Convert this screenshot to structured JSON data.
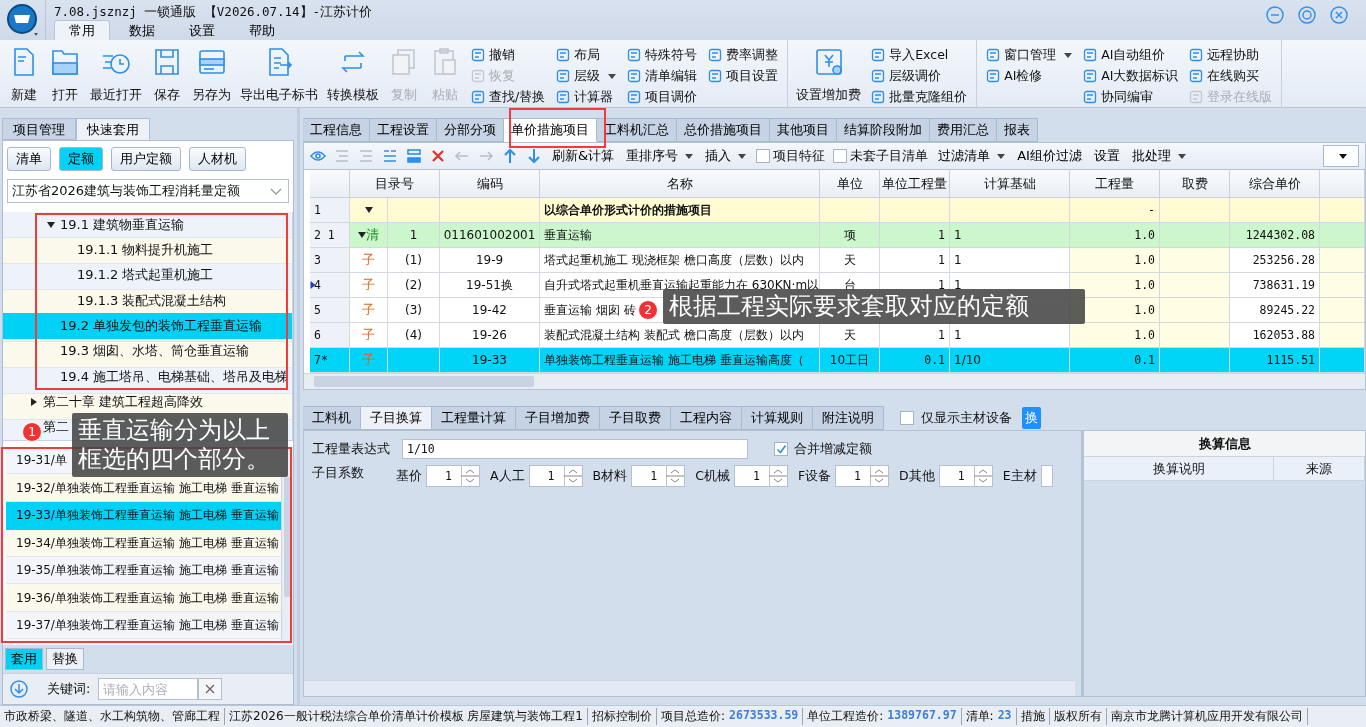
{
  "window": {
    "title": "7.08.jsznzj 一锁通版 【V2026.07.14】-江苏计价"
  },
  "menu_tabs": [
    {
      "label": "常用",
      "selected": true
    },
    {
      "label": "数据",
      "selected": false
    },
    {
      "label": "设置",
      "selected": false
    },
    {
      "label": "帮助",
      "selected": false
    }
  ],
  "toolbar": [
    [
      {
        "kind": "big",
        "label": "新建",
        "disabled": false
      },
      {
        "kind": "big",
        "label": "打开",
        "disabled": false
      },
      {
        "kind": "big",
        "label": "最近打开",
        "disabled": false
      },
      {
        "kind": "big",
        "label": "保存",
        "disabled": false
      },
      {
        "kind": "big",
        "label": "另存为",
        "disabled": false
      },
      {
        "kind": "big",
        "label": "导出电子标书",
        "disabled": false
      },
      {
        "kind": "big",
        "label": "转换模板",
        "disabled": false
      },
      {
        "kind": "big",
        "label": "复制",
        "disabled": true
      },
      {
        "kind": "big",
        "label": "粘贴",
        "disabled": true
      },
      {
        "kind": "column",
        "items": [
          {
            "label": "撤销",
            "disabled": false,
            "dropdown": false
          },
          {
            "label": "恢复",
            "disabled": true,
            "dropdown": false
          },
          {
            "label": "查找/替换",
            "disabled": false,
            "dropdown": false
          }
        ]
      },
      {
        "kind": "column",
        "items": [
          {
            "label": "布局",
            "disabled": false,
            "dropdown": false
          },
          {
            "label": "层级",
            "disabled": false,
            "dropdown": true
          },
          {
            "label": "计算器",
            "disabled": false,
            "dropdown": false
          }
        ]
      },
      {
        "kind": "column",
        "items": [
          {
            "label": "特殊符号",
            "disabled": false,
            "dropdown": false
          },
          {
            "label": "清单编辑",
            "disabled": false,
            "dropdown": false
          },
          {
            "label": "项目调价",
            "disabled": false,
            "dropdown": false
          }
        ]
      },
      {
        "kind": "column",
        "items": [
          {
            "label": "费率调整",
            "disabled": false,
            "dropdown": false
          },
          {
            "label": "项目设置",
            "disabled": false,
            "dropdown": false
          }
        ]
      }
    ],
    [
      {
        "kind": "big",
        "label": "设置增加费",
        "disabled": false
      },
      {
        "kind": "column",
        "items": [
          {
            "label": "导入Excel",
            "disabled": false,
            "dropdown": false
          },
          {
            "label": "层级调价",
            "disabled": false,
            "dropdown": false
          },
          {
            "label": "批量克隆组价",
            "disabled": false,
            "dropdown": false
          }
        ]
      }
    ],
    [
      {
        "kind": "column",
        "items": [
          {
            "label": "窗口管理",
            "disabled": false,
            "dropdown": true
          },
          {
            "label": "AI检修",
            "disabled": false,
            "dropdown": false
          }
        ]
      },
      {
        "kind": "column",
        "items": [
          {
            "label": "AI自动组价",
            "disabled": false,
            "dropdown": false
          },
          {
            "label": "AI大数据标识",
            "disabled": false,
            "dropdown": false
          },
          {
            "label": "协同编审",
            "disabled": false,
            "dropdown": false
          }
        ]
      },
      {
        "kind": "column",
        "items": [
          {
            "label": "远程协助",
            "disabled": false,
            "dropdown": false
          },
          {
            "label": "在线购买",
            "disabled": false,
            "dropdown": false
          },
          {
            "label": "登录在线版",
            "disabled": true,
            "dropdown": false
          }
        ]
      }
    ]
  ],
  "left_panel": {
    "tabs": [
      {
        "label": "项目管理",
        "selected": false
      },
      {
        "label": "快速套用",
        "selected": true
      }
    ],
    "filter_buttons": [
      {
        "label": "清单",
        "selected": false
      },
      {
        "label": "定额",
        "selected": true
      },
      {
        "label": "用户定额",
        "selected": false
      },
      {
        "label": "人材机",
        "selected": false
      }
    ],
    "library": {
      "value": "江苏省2026建筑与装饰工程消耗量定额"
    },
    "tree": [
      {
        "children": [
          {
            "label": "19.1 建筑物垂直运输",
            "expanded": true,
            "selected": false,
            "children": [
              {
                "label": "19.1.1 物料提升机施工",
                "selected": false
              },
              {
                "label": "19.1.2 塔式起重机施工",
                "selected": false
              },
              {
                "label": "19.1.3 装配式混凝土结构",
                "selected": false
              }
            ]
          },
          {
            "label": "19.2 单独发包的装饰工程垂直运输",
            "selected": true
          },
          {
            "label": "19.3 烟囱、水塔、筒仓垂直运输",
            "selected": false
          },
          {
            "label": "19.4 施工塔吊、电梯基础、塔吊及电梯",
            "selected": false
          }
        ]
      },
      {
        "label": "第二十章 建筑工程超高降效",
        "expanded": false,
        "selected": false
      },
      {
        "label": "第二",
        "selected": false
      }
    ],
    "norms": [
      {
        "text": "19-31/单",
        "selected": false
      },
      {
        "text": "19-32/单独装饰工程垂直运输 施工电梯 垂直运输",
        "selected": false
      },
      {
        "text": "19-33/单独装饰工程垂直运输 施工电梯 垂直运输",
        "selected": true
      },
      {
        "text": "19-34/单独装饰工程垂直运输 施工电梯 垂直运输",
        "selected": false
      },
      {
        "text": "19-35/单独装饰工程垂直运输 施工电梯 垂直运输",
        "selected": false
      },
      {
        "text": "19-36/单独装饰工程垂直运输 施工电梯 垂直运输",
        "selected": false
      },
      {
        "text": "19-37/单独装饰工程垂直运输 施工电梯 垂直运输",
        "selected": false
      }
    ],
    "action_tabs": [
      {
        "label": "套用",
        "selected": true
      },
      {
        "label": "替换",
        "selected": false
      }
    ],
    "keyword": {
      "label": "关键词:",
      "placeholder": "请输入内容"
    }
  },
  "main_tabs": [
    {
      "label": "工程信息",
      "selected": false
    },
    {
      "label": "工程设置",
      "selected": false
    },
    {
      "label": "分部分项",
      "selected": false
    },
    {
      "label": "单价措施项目",
      "selected": true
    },
    {
      "label": "工料机汇总",
      "selected": false
    },
    {
      "label": "总价措施项目",
      "selected": false
    },
    {
      "label": "其他项目",
      "selected": false
    },
    {
      "label": "结算阶段附加",
      "selected": false
    },
    {
      "label": "费用汇总",
      "selected": false
    },
    {
      "label": "报表",
      "selected": false
    }
  ],
  "grid_toolbar": {
    "icons": [
      {
        "kind": "eye",
        "disabled": false
      },
      {
        "kind": "lines",
        "disabled": true
      },
      {
        "kind": "lines",
        "disabled": true
      },
      {
        "kind": "list",
        "disabled": false
      },
      {
        "kind": "stack",
        "disabled": false
      },
      {
        "kind": "delete",
        "disabled": false
      },
      {
        "kind": "left",
        "disabled": true
      },
      {
        "kind": "right",
        "disabled": true
      },
      {
        "kind": "up",
        "disabled": false
      },
      {
        "kind": "down",
        "disabled": false
      }
    ],
    "items": [
      {
        "kind": "button",
        "label": "刷新&计算",
        "dropdown": false
      },
      {
        "kind": "button",
        "label": "重排序号",
        "dropdown": true
      },
      {
        "kind": "button",
        "label": "插入",
        "dropdown": true
      },
      {
        "kind": "checkbox",
        "label": "项目特征",
        "checked": false
      },
      {
        "kind": "checkbox",
        "label": "未套子目清单",
        "checked": false
      },
      {
        "kind": "button",
        "label": "过滤清单",
        "dropdown": true
      },
      {
        "kind": "button",
        "label": "AI组价过滤",
        "dropdown": false
      },
      {
        "kind": "button",
        "label": "设置",
        "dropdown": false
      },
      {
        "kind": "button",
        "label": "批处理",
        "dropdown": true
      }
    ]
  },
  "table": {
    "columns": [
      "目录号",
      "编码",
      "名称",
      "单位",
      "单位工程量",
      "计算基础",
      "工程量",
      "取费",
      "综合单价"
    ],
    "rows": [
      {
        "no": "1",
        "kind": "group",
        "expanded": true,
        "current": false,
        "selected": false,
        "name": "以综合单价形式计价的措施项目",
        "qty": "-"
      },
      {
        "no": "2 1",
        "kind": "list",
        "expanded": true,
        "tag": "清",
        "seq": "1",
        "current": false,
        "selected": false,
        "code": "011601002001",
        "name": "垂直运输",
        "unit": "项",
        "unit_qty": "1",
        "basis": "1",
        "qty": "1.0",
        "price": "1244302.08"
      },
      {
        "no": "3",
        "kind": "item",
        "tag": "子",
        "seq": "(1)",
        "current": false,
        "selected": false,
        "code": "19-9",
        "name": "塔式起重机施工 现浇框架 檐口高度（层数）以内",
        "unit": "天",
        "unit_qty": "1",
        "basis": "1",
        "qty": "1.0",
        "price": "253256.28"
      },
      {
        "no": "4",
        "kind": "item",
        "tag": "子",
        "seq": "(2)",
        "current": true,
        "selected": false,
        "code": "19-51换",
        "name": "自升式塔式起重机垂直运输起重能力在 630KN·m以",
        "unit": "台",
        "unit_qty": "1",
        "basis": "1",
        "qty": "1.0",
        "price": "738631.19"
      },
      {
        "no": "5",
        "kind": "item",
        "tag": "子",
        "seq": "(3)",
        "current": false,
        "selected": false,
        "code": "19-42",
        "name": "垂直运输 烟囱 砖",
        "qty": "1.0",
        "price": "89245.22"
      },
      {
        "no": "6",
        "kind": "item",
        "tag": "子",
        "seq": "(4)",
        "current": false,
        "selected": false,
        "code": "19-26",
        "name": "装配式混凝土结构 装配式 檐口高度（层数）以内",
        "unit": "天",
        "unit_qty": "1",
        "basis": "1",
        "qty": "1.0",
        "price": "162053.88"
      },
      {
        "no": "7*",
        "kind": "item",
        "tag": "子",
        "current": false,
        "selected": true,
        "code": "19-33",
        "name": "单独装饰工程垂直运输 施工电梯 垂直运输高度（",
        "unit": "10工日",
        "unit_qty": "0.1",
        "basis": "1/10",
        "qty": "0.1",
        "price": "1115.51"
      }
    ]
  },
  "detail_tabs": [
    {
      "label": "工料机",
      "selected": false
    },
    {
      "label": "子目换算",
      "selected": true
    },
    {
      "label": "工程量计算",
      "selected": false
    },
    {
      "label": "子目增加费",
      "selected": false
    },
    {
      "label": "子目取费",
      "selected": false
    },
    {
      "label": "工程内容",
      "selected": false
    },
    {
      "label": "计算规则",
      "selected": false
    },
    {
      "label": "附注说明",
      "selected": false
    }
  ],
  "main_only_filter": {
    "label": "仅显示主材设备",
    "checked": false
  },
  "swap_button": {
    "label": "换"
  },
  "conversion": {
    "expression_label": "工程量表达式",
    "expression": "1/10",
    "merge": {
      "label": "合并增减定额",
      "checked": true
    },
    "coef_label": "子目系数",
    "coefficients": [
      {
        "label": "基价",
        "value": "1"
      },
      {
        "label": "A人工",
        "value": "1"
      },
      {
        "label": "B材料",
        "value": "1"
      },
      {
        "label": "C机械",
        "value": "1"
      },
      {
        "label": "F设备",
        "value": "1"
      },
      {
        "label": "D其他",
        "value": "1"
      },
      {
        "label": "E主材"
      }
    ]
  },
  "conversion_info": {
    "title": "换算信息",
    "columns": [
      "换算说明",
      "来源"
    ]
  },
  "status_bar": [
    {
      "text": "市政桥梁、隧道、水工构筑物、管廊工程"
    },
    {
      "text": "江苏2026一般计税法综合单价清单计价模板 房屋建筑与装饰工程1"
    },
    {
      "text": "招标控制价"
    },
    {
      "text": "项目总造价:",
      "value": "2673533.59"
    },
    {
      "text": "单位工程造价:",
      "value": "1389767.97"
    },
    {
      "text": "清单:",
      "value": "23"
    },
    {
      "text": "措施"
    },
    {
      "text": "版权所有"
    },
    {
      "text": "南京市龙腾计算机应用开发有限公司"
    }
  ],
  "callouts": [
    {
      "number": "1",
      "text": "垂直运输分为以上框选的四个部分。"
    },
    {
      "number": "2",
      "text": "根据工程实际要求套取对应的定额"
    }
  ]
}
